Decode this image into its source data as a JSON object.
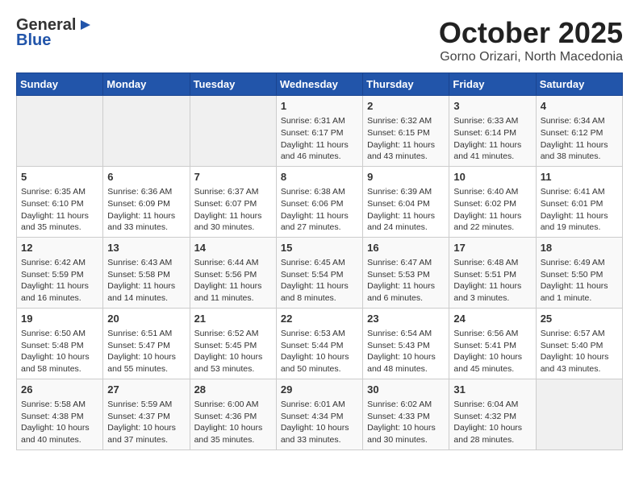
{
  "header": {
    "logo_general": "General",
    "logo_blue": "Blue",
    "month": "October 2025",
    "location": "Gorno Orizari, North Macedonia"
  },
  "weekdays": [
    "Sunday",
    "Monday",
    "Tuesday",
    "Wednesday",
    "Thursday",
    "Friday",
    "Saturday"
  ],
  "weeks": [
    [
      {
        "day": "",
        "info": ""
      },
      {
        "day": "",
        "info": ""
      },
      {
        "day": "",
        "info": ""
      },
      {
        "day": "1",
        "info": "Sunrise: 6:31 AM\nSunset: 6:17 PM\nDaylight: 11 hours and 46 minutes."
      },
      {
        "day": "2",
        "info": "Sunrise: 6:32 AM\nSunset: 6:15 PM\nDaylight: 11 hours and 43 minutes."
      },
      {
        "day": "3",
        "info": "Sunrise: 6:33 AM\nSunset: 6:14 PM\nDaylight: 11 hours and 41 minutes."
      },
      {
        "day": "4",
        "info": "Sunrise: 6:34 AM\nSunset: 6:12 PM\nDaylight: 11 hours and 38 minutes."
      }
    ],
    [
      {
        "day": "5",
        "info": "Sunrise: 6:35 AM\nSunset: 6:10 PM\nDaylight: 11 hours and 35 minutes."
      },
      {
        "day": "6",
        "info": "Sunrise: 6:36 AM\nSunset: 6:09 PM\nDaylight: 11 hours and 33 minutes."
      },
      {
        "day": "7",
        "info": "Sunrise: 6:37 AM\nSunset: 6:07 PM\nDaylight: 11 hours and 30 minutes."
      },
      {
        "day": "8",
        "info": "Sunrise: 6:38 AM\nSunset: 6:06 PM\nDaylight: 11 hours and 27 minutes."
      },
      {
        "day": "9",
        "info": "Sunrise: 6:39 AM\nSunset: 6:04 PM\nDaylight: 11 hours and 24 minutes."
      },
      {
        "day": "10",
        "info": "Sunrise: 6:40 AM\nSunset: 6:02 PM\nDaylight: 11 hours and 22 minutes."
      },
      {
        "day": "11",
        "info": "Sunrise: 6:41 AM\nSunset: 6:01 PM\nDaylight: 11 hours and 19 minutes."
      }
    ],
    [
      {
        "day": "12",
        "info": "Sunrise: 6:42 AM\nSunset: 5:59 PM\nDaylight: 11 hours and 16 minutes."
      },
      {
        "day": "13",
        "info": "Sunrise: 6:43 AM\nSunset: 5:58 PM\nDaylight: 11 hours and 14 minutes."
      },
      {
        "day": "14",
        "info": "Sunrise: 6:44 AM\nSunset: 5:56 PM\nDaylight: 11 hours and 11 minutes."
      },
      {
        "day": "15",
        "info": "Sunrise: 6:45 AM\nSunset: 5:54 PM\nDaylight: 11 hours and 8 minutes."
      },
      {
        "day": "16",
        "info": "Sunrise: 6:47 AM\nSunset: 5:53 PM\nDaylight: 11 hours and 6 minutes."
      },
      {
        "day": "17",
        "info": "Sunrise: 6:48 AM\nSunset: 5:51 PM\nDaylight: 11 hours and 3 minutes."
      },
      {
        "day": "18",
        "info": "Sunrise: 6:49 AM\nSunset: 5:50 PM\nDaylight: 11 hours and 1 minute."
      }
    ],
    [
      {
        "day": "19",
        "info": "Sunrise: 6:50 AM\nSunset: 5:48 PM\nDaylight: 10 hours and 58 minutes."
      },
      {
        "day": "20",
        "info": "Sunrise: 6:51 AM\nSunset: 5:47 PM\nDaylight: 10 hours and 55 minutes."
      },
      {
        "day": "21",
        "info": "Sunrise: 6:52 AM\nSunset: 5:45 PM\nDaylight: 10 hours and 53 minutes."
      },
      {
        "day": "22",
        "info": "Sunrise: 6:53 AM\nSunset: 5:44 PM\nDaylight: 10 hours and 50 minutes."
      },
      {
        "day": "23",
        "info": "Sunrise: 6:54 AM\nSunset: 5:43 PM\nDaylight: 10 hours and 48 minutes."
      },
      {
        "day": "24",
        "info": "Sunrise: 6:56 AM\nSunset: 5:41 PM\nDaylight: 10 hours and 45 minutes."
      },
      {
        "day": "25",
        "info": "Sunrise: 6:57 AM\nSunset: 5:40 PM\nDaylight: 10 hours and 43 minutes."
      }
    ],
    [
      {
        "day": "26",
        "info": "Sunrise: 5:58 AM\nSunset: 4:38 PM\nDaylight: 10 hours and 40 minutes."
      },
      {
        "day": "27",
        "info": "Sunrise: 5:59 AM\nSunset: 4:37 PM\nDaylight: 10 hours and 37 minutes."
      },
      {
        "day": "28",
        "info": "Sunrise: 6:00 AM\nSunset: 4:36 PM\nDaylight: 10 hours and 35 minutes."
      },
      {
        "day": "29",
        "info": "Sunrise: 6:01 AM\nSunset: 4:34 PM\nDaylight: 10 hours and 33 minutes."
      },
      {
        "day": "30",
        "info": "Sunrise: 6:02 AM\nSunset: 4:33 PM\nDaylight: 10 hours and 30 minutes."
      },
      {
        "day": "31",
        "info": "Sunrise: 6:04 AM\nSunset: 4:32 PM\nDaylight: 10 hours and 28 minutes."
      },
      {
        "day": "",
        "info": ""
      }
    ]
  ]
}
